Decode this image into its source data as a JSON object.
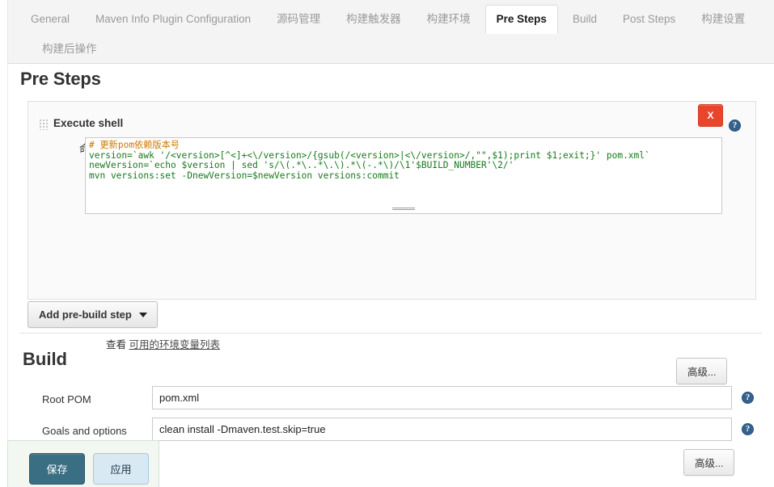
{
  "tabs": {
    "row1": [
      {
        "label": "General",
        "active": false
      },
      {
        "label": "Maven Info Plugin Configuration",
        "active": false
      },
      {
        "label": "源码管理",
        "active": false
      },
      {
        "label": "构建触发器",
        "active": false
      },
      {
        "label": "构建环境",
        "active": false
      },
      {
        "label": "Pre Steps",
        "active": true
      },
      {
        "label": "Build",
        "active": false
      },
      {
        "label": "Post Steps",
        "active": false
      },
      {
        "label": "构建设置",
        "active": false
      }
    ],
    "row2": [
      {
        "label": "构建后操作",
        "active": false
      }
    ]
  },
  "pre_steps": {
    "heading": "Pre Steps",
    "builder": {
      "title": "Execute shell",
      "delete_label": "X",
      "help_label": "?",
      "command_label": "命令",
      "script_lines": [
        "# 更新pom依赖版本号",
        "version=`awk '/<version>[^<]+<\\/version>/{gsub(/<version>|<\\/version>/,\"\",$1);print $1;exit;}' pom.xml`",
        "newVersion=`echo $version | sed 's/\\(.*\\..*\\.\\).*\\(-.*\\)/\\1'$BUILD_NUMBER'\\2/'",
        "mvn versions:set -DnewVersion=$newVersion versions:commit"
      ],
      "env_text": "查看",
      "env_link": "可用的环境变量列表",
      "advanced_label": "高级..."
    },
    "add_step_label": "Add pre-build step"
  },
  "build": {
    "heading": "Build",
    "fields": [
      {
        "label": "Root POM",
        "value": "pom.xml",
        "help": "?"
      },
      {
        "label": "Goals and options",
        "value": "clean install -Dmaven.test.skip=true",
        "help": "?"
      }
    ],
    "advanced_label": "高级..."
  },
  "footer": {
    "save_label": "保存",
    "apply_label": "应用"
  },
  "colors": {
    "accent_tab": "#1a1a1a",
    "delete_red": "#e8452c",
    "help_blue": "#35618f",
    "save_teal": "#3a6e82",
    "apply_blue": "#d8e9f3",
    "comment_orange": "#cc7a00",
    "code_green": "#17791c",
    "code_blue": "#1a2ecb"
  }
}
